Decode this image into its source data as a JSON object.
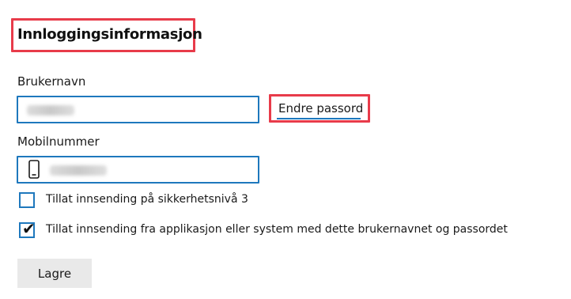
{
  "section": {
    "title": "Innloggingsinformasjon"
  },
  "username": {
    "label": "Brukernavn",
    "change_password_label": "Endre passord"
  },
  "mobile": {
    "label": "Mobilnummer"
  },
  "options": [
    {
      "label": "Tillat innsending på sikkerhetsnivå 3",
      "checked": false
    },
    {
      "label": "Tillat innsending fra applikasjon eller system med dette brukernavnet og passordet",
      "checked": true
    }
  ],
  "actions": {
    "save_label": "Lagre"
  },
  "colors": {
    "accent": "#1e78bd",
    "highlight": "#e83b4a",
    "button_bg": "#e9e9e9"
  },
  "icons": {
    "phone": "mobile-phone-icon",
    "check": "checkmark-icon"
  }
}
